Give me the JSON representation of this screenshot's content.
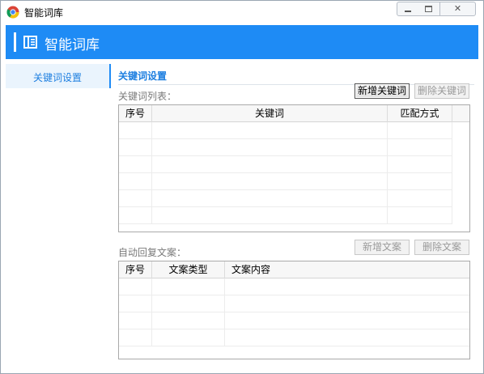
{
  "window": {
    "title": "智能词库"
  },
  "header": {
    "title": "智能词库"
  },
  "sidebar": {
    "items": [
      {
        "label": "关键词设置",
        "active": true
      }
    ]
  },
  "main": {
    "title": "关键词设置",
    "keyword_section": {
      "label": "关键词列表：",
      "add_button": "新增关键词",
      "delete_button": "删除关键词",
      "columns": [
        "序号",
        "关键词",
        "匹配方式"
      ],
      "rows": []
    },
    "reply_section": {
      "label": "自动回复文案：",
      "add_button": "新增文案",
      "delete_button": "删除文案",
      "columns": [
        "序号",
        "文案类型",
        "文案内容"
      ],
      "rows": []
    }
  },
  "colors": {
    "accent": "#1e8bf5",
    "accent_text": "#1e7fe0",
    "muted_text": "#7a7a7a"
  },
  "icons": {
    "app": "chrome-icon",
    "header": "panel-book-icon"
  }
}
